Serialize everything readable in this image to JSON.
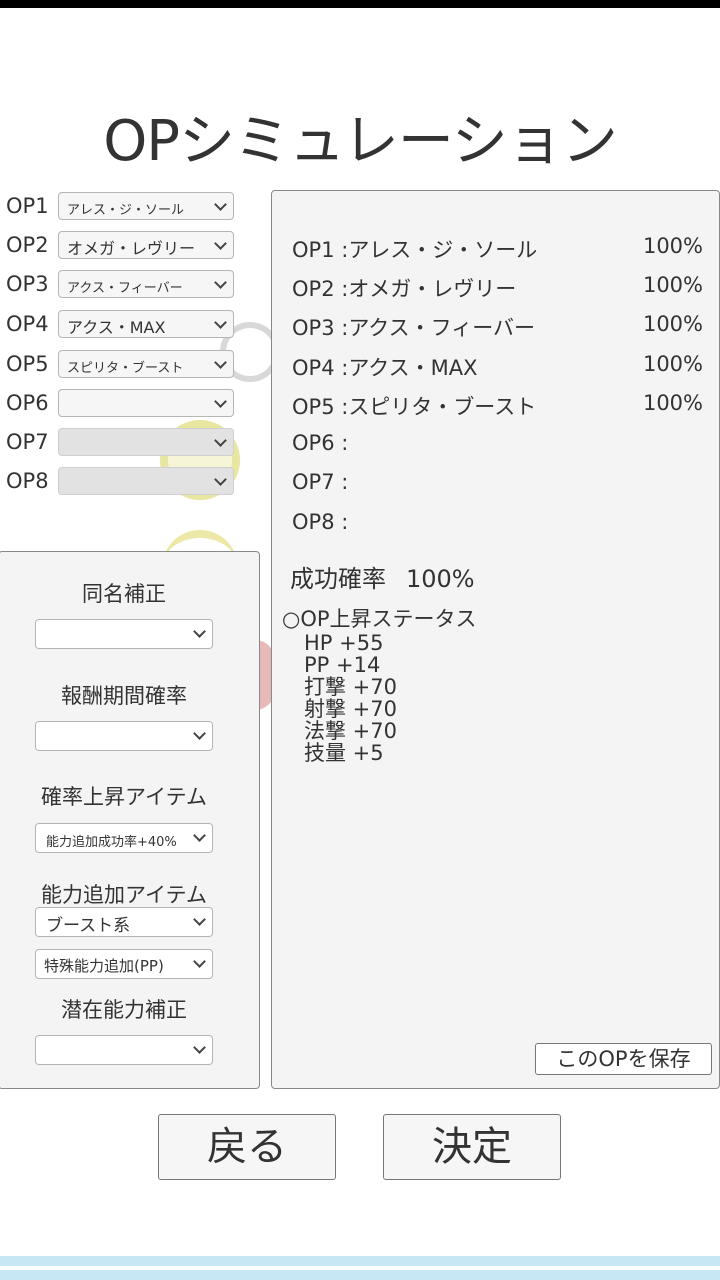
{
  "title": "OPシミュレーション",
  "op_selectors": [
    {
      "label": "OP1",
      "value": "アレス・ジ・ソール",
      "disabled": false
    },
    {
      "label": "OP2",
      "value": "オメガ・レヴリー",
      "disabled": false
    },
    {
      "label": "OP3",
      "value": "アクス・フィーバー",
      "disabled": false
    },
    {
      "label": "OP4",
      "value": "アクス・MAX",
      "disabled": false
    },
    {
      "label": "OP5",
      "value": "スピリタ・ブースト",
      "disabled": false
    },
    {
      "label": "OP6",
      "value": "",
      "disabled": false
    },
    {
      "label": "OP7",
      "value": "",
      "disabled": true
    },
    {
      "label": "OP8",
      "value": "",
      "disabled": true
    }
  ],
  "left_panel": {
    "same_name_label": "同名補正",
    "same_name_value": "",
    "reward_period_label": "報酬期間確率",
    "reward_period_value": "",
    "rate_item_label": "確率上昇アイテム",
    "rate_item_value": "能力追加成功率+40%",
    "ability_item_label": "能力追加アイテム",
    "ability_item_type": "ブースト系",
    "ability_item_value": "特殊能力追加(PP)",
    "potential_label": "潜在能力補正",
    "potential_value": ""
  },
  "result_panel": {
    "ops": [
      {
        "label": "OP1 :",
        "name": "アレス・ジ・ソール",
        "rate": "100%"
      },
      {
        "label": "OP2 :",
        "name": "オメガ・レヴリー",
        "rate": "100%"
      },
      {
        "label": "OP3 :",
        "name": "アクス・フィーバー",
        "rate": "100%"
      },
      {
        "label": "OP4 :",
        "name": "アクス・MAX",
        "rate": "100%"
      },
      {
        "label": "OP5 :",
        "name": "スピリタ・ブースト",
        "rate": "100%"
      },
      {
        "label": "OP6 :",
        "name": "",
        "rate": ""
      },
      {
        "label": "OP7 :",
        "name": "",
        "rate": ""
      },
      {
        "label": "OP8 :",
        "name": "",
        "rate": ""
      }
    ],
    "success_label": "成功確率",
    "success_value": "100%",
    "status_title": "○OP上昇ステータス",
    "stats": [
      "HP  +55",
      "PP  +14",
      "打撃  +70",
      "射撃  +70",
      "法撃  +70",
      "技量  +5"
    ],
    "save_label": "このOPを保存"
  },
  "buttons": {
    "back_label": "戻る",
    "confirm_label": "決定"
  },
  "colors": {
    "panel_bg": "#f4f4f4",
    "stripe": "#c6e7f3"
  }
}
